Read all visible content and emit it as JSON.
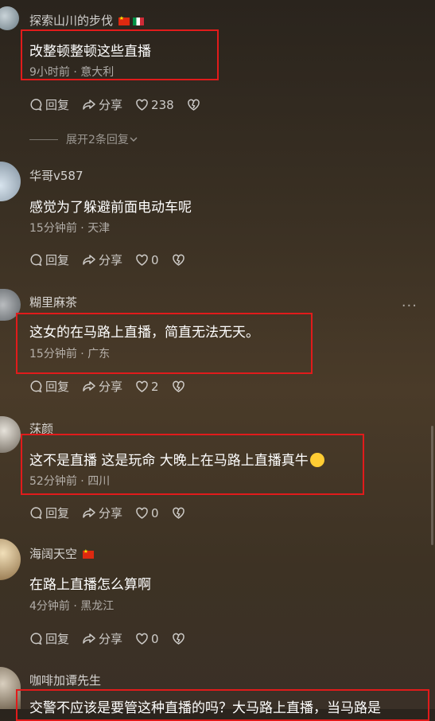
{
  "comments": [
    {
      "user": "探索山川的步伐",
      "flags": [
        "cn",
        "it"
      ],
      "text": "改整顿整顿这些直播",
      "time": "9小时前",
      "location": "意大利",
      "reply": "回复",
      "share": "分享",
      "likes": "238",
      "expand": "展开2条回复"
    },
    {
      "user": "华哥v587",
      "flags": [],
      "text": "感觉为了躲避前面电动车呢",
      "time": "15分钟前",
      "location": "天津",
      "reply": "回复",
      "share": "分享",
      "likes": "0"
    },
    {
      "user": "糊里麻茶",
      "flags": [],
      "text": "这女的在马路上直播，简直无法无天。",
      "time": "15分钟前",
      "location": "广东",
      "reply": "回复",
      "share": "分享",
      "likes": "2"
    },
    {
      "user": "莯颜",
      "flags": [],
      "text": "这不是直播 这是玩命 大晚上在马路上直播真牛",
      "time": "52分钟前",
      "location": "四川",
      "reply": "回复",
      "share": "分享",
      "likes": "0"
    },
    {
      "user": "海阔天空",
      "flags": [
        "cn"
      ],
      "text": "在路上直播怎么算啊",
      "time": "4分钟前",
      "location": "黑龙江",
      "reply": "回复",
      "share": "分享",
      "likes": "0"
    },
    {
      "user": "咖啡加谭先生",
      "flags": [],
      "text": "交警不应该是要管这种直播的吗？大马路上直播，当马路是",
      "time": "",
      "location": ""
    }
  ],
  "separator": " · ",
  "more_label": "···"
}
